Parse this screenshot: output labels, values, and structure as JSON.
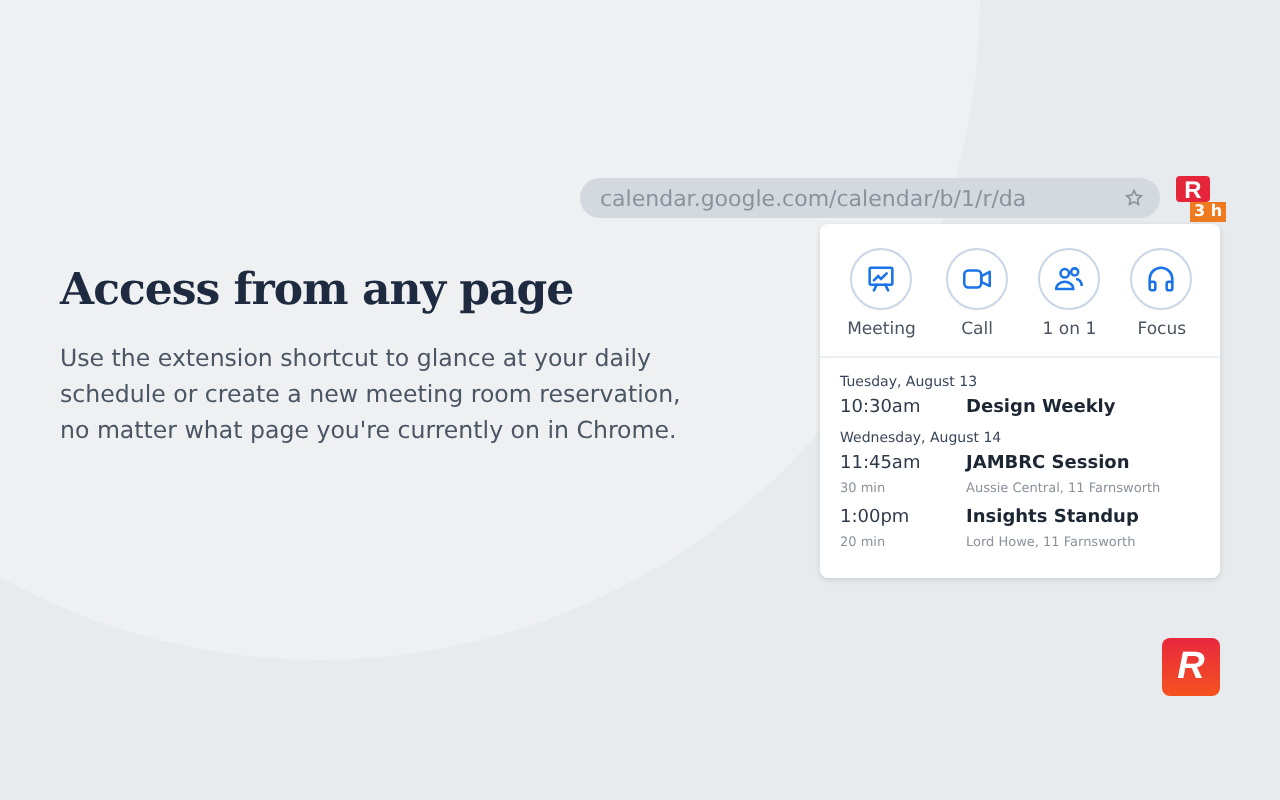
{
  "browser_bar": {
    "url": "calendar.google.com/calendar/b/1/r/da",
    "extension": {
      "letter": "R",
      "badge": "3 h"
    }
  },
  "headline": "Access from any page",
  "description": "Use the extension shortcut to glance at your daily schedule or create a new meeting room reservation, no matter what page you're currently on in Chrome.",
  "popup": {
    "actions": [
      {
        "kind": "meeting",
        "label": "Meeting"
      },
      {
        "kind": "call",
        "label": "Call"
      },
      {
        "kind": "one_on_one",
        "label": "1 on 1"
      },
      {
        "kind": "focus",
        "label": "Focus"
      }
    ],
    "days": [
      {
        "date": "Tuesday, August 13",
        "events": [
          {
            "time": "10:30am",
            "title": "Design Weekly"
          }
        ]
      },
      {
        "date": "Wednesday, August 14",
        "events": [
          {
            "time": "11:45am",
            "duration": "30 min",
            "title": "JAMBRC Session",
            "location": "Aussie Central, 11 Farnsworth"
          },
          {
            "time": "1:00pm",
            "duration": "20 min",
            "title": "Insights Standup",
            "location": "Lord Howe, 11 Farnsworth"
          }
        ]
      }
    ]
  },
  "logo": {
    "letter": "R"
  }
}
